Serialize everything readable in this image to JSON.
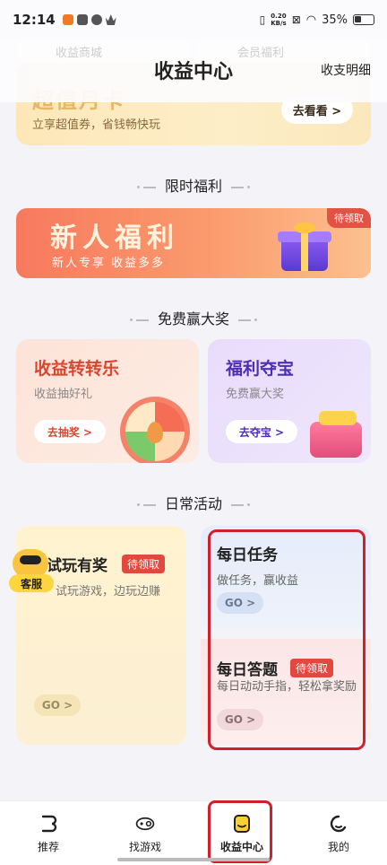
{
  "status": {
    "time": "12:14",
    "net_speed_value": "0.20",
    "net_speed_unit": "KB/s",
    "battery": "35%"
  },
  "header": {
    "title": "收益中心",
    "ledger": "收支明细",
    "ghost_left": "收益商城",
    "ghost_right": "会员福利"
  },
  "vip_card": {
    "title": "超值月卡",
    "subtitle": "立享超值券，省钱畅快玩",
    "button": "去看看 >"
  },
  "sections": {
    "limited": "限时福利",
    "free": "免费赢大奖",
    "daily": "日常活动"
  },
  "newbie": {
    "title": "新人福利",
    "subtitle": "新人专享 收益多多",
    "badge": "待领取"
  },
  "wheel_card": {
    "title": "收益转转乐",
    "subtitle": "收益抽好礼",
    "button": "去抽奖 >"
  },
  "treasure_card": {
    "title": "福利夺宝",
    "subtitle": "免费赢大奖",
    "button": "去夺宝 >"
  },
  "daily": {
    "play": {
      "title": "试玩有奖",
      "badge": "待领取",
      "subtitle": "试玩游戏，边玩边赚",
      "go": "GO >"
    },
    "task": {
      "title": "每日任务",
      "subtitle": "做任务，赢收益",
      "go": "GO >"
    },
    "quiz": {
      "title": "每日答题",
      "badge": "待领取",
      "subtitle": "每日动动手指，轻松拿奖励",
      "go": "GO >"
    }
  },
  "customer_service": {
    "label": "客服"
  },
  "tabs": [
    {
      "label": "推荐",
      "icon": "recommend-icon"
    },
    {
      "label": "找游戏",
      "icon": "gamepad-icon"
    },
    {
      "label": "收益中心",
      "icon": "wallet-icon",
      "active": true
    },
    {
      "label": "我的",
      "icon": "profile-icon"
    }
  ],
  "colors": {
    "accent_red": "#d1202c",
    "badge_red": "#e2483d",
    "newbie_orange": "#f7795e"
  }
}
